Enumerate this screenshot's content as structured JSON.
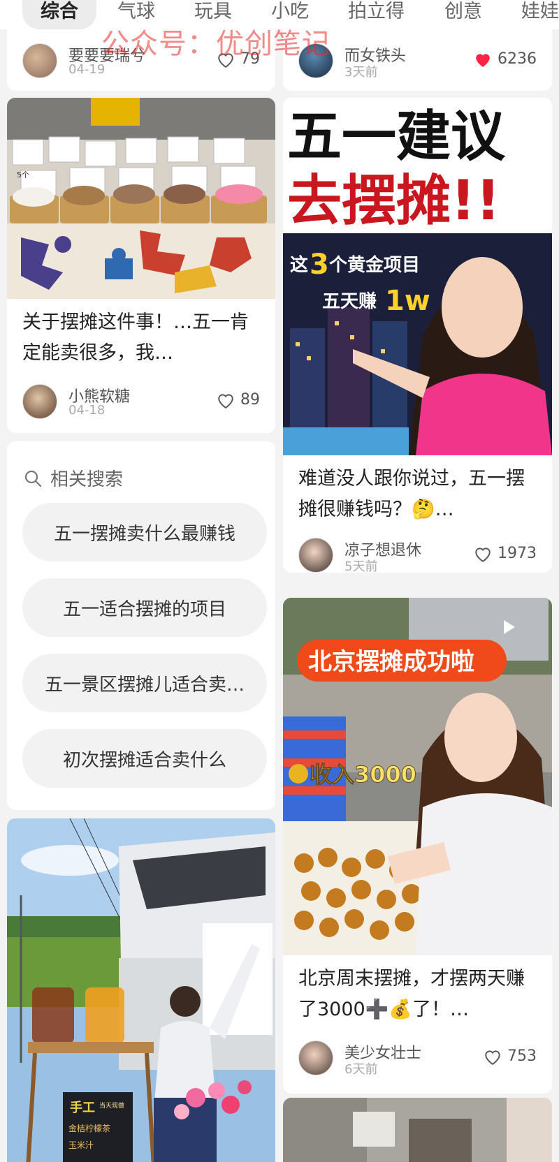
{
  "tabs": [
    "综合",
    "气球",
    "玩具",
    "小吃",
    "拍立得",
    "创意",
    "娃娃"
  ],
  "watermark": "公众号：优创笔记",
  "cards": {
    "top_left": {
      "author": "要要要瑞兮",
      "date": "04-19",
      "likes": "79"
    },
    "top_right": {
      "author": "而女铁头",
      "date": "3天前",
      "likes": "6236"
    },
    "stall": {
      "title": "关于摆摊这件事！…五一肯定能卖很多，我…",
      "author": "小熊软糖",
      "date": "04-18",
      "likes": "89",
      "image_text": "5个"
    },
    "wuyi": {
      "cover_line1": "五一建议",
      "cover_line2": "去摆摊!!",
      "cover_tag1_a": "这",
      "cover_tag1_num": "3",
      "cover_tag1_b": "个黄金项目",
      "cover_tag2_a": "五天赚",
      "cover_tag2_b": "1w",
      "title": "难道没人跟你说过，五一摆摊很赚钱吗？🤔…",
      "author": "凉子想退休",
      "date": "5天前",
      "likes": "1973"
    },
    "beijing": {
      "cover_banner": "北京摆摊成功啦",
      "cover_income": "收入3000",
      "title": "北京周末摆摊，才摆两天赚了3000➕💰了！…",
      "author": "美少女壮士",
      "date": "6天前",
      "likes": "753"
    }
  },
  "related_search": {
    "header": "相关搜索",
    "items": [
      "五一摆摊卖什么最赚钱",
      "五一适合摆摊的项目",
      "五一景区摆摊儿适合卖…",
      "初次摆摊适合卖什么"
    ]
  },
  "bottom_left_sign": {
    "line1": "手工",
    "line2": "当天现做",
    "line3": "金桔柠檬茶",
    "line4": "玉米汁"
  },
  "colors": {
    "like_red": "#ff2442",
    "tab_bg": "#ececec"
  }
}
